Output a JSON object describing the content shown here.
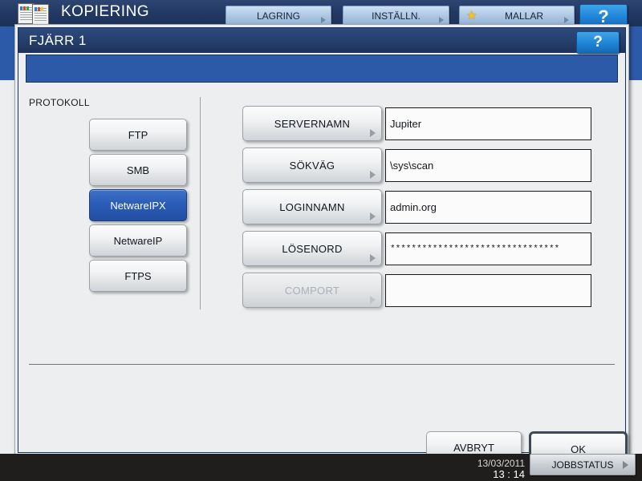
{
  "app": {
    "title": "KOPIERING",
    "icon": "copy-document-icon",
    "help_label": "?",
    "tabs": [
      {
        "label": "LAGRING",
        "icon": "chevron-right-icon"
      },
      {
        "label": "INSTÄLLN.",
        "icon": "chevron-right-icon"
      },
      {
        "label": "MALLAR",
        "icon": "star-icon"
      }
    ]
  },
  "dialog": {
    "title": "FJÄRR 1",
    "help_label": "?",
    "section_label": "PROTOKOLL",
    "protocols": [
      {
        "label": "FTP",
        "selected": false
      },
      {
        "label": "SMB",
        "selected": false
      },
      {
        "label": "NetwareIPX",
        "selected": true
      },
      {
        "label": "NetwareIP",
        "selected": false
      },
      {
        "label": "FTPS",
        "selected": false
      }
    ],
    "fields": [
      {
        "label": "SERVERNAMN",
        "value": "Jupiter",
        "disabled": false,
        "masked": false
      },
      {
        "label": "SÖKVÄG",
        "value": "\\sys\\scan",
        "disabled": false,
        "masked": false
      },
      {
        "label": "LOGINNAMN",
        "value": "admin.org",
        "disabled": false,
        "masked": false
      },
      {
        "label": "LÖSENORD",
        "value": "********************************",
        "disabled": false,
        "masked": true
      },
      {
        "label": "COMPORT",
        "value": "",
        "disabled": true,
        "masked": false
      }
    ],
    "cancel_label": "AVBRYT",
    "ok_label": "OK"
  },
  "statusbar": {
    "date": "13/03/2011",
    "time": "13 : 14",
    "job_status_label": "JOBBSTATUS",
    "job_status_icon": "chevron-right-icon"
  },
  "colors": {
    "accent_blue": "#2c5aa8",
    "header_navy": "#223963",
    "selected_button": "#2a5cb8",
    "help_button": "#1f83d6",
    "panel_gray": "#eceef0",
    "star_yellow": "#f6c223"
  }
}
